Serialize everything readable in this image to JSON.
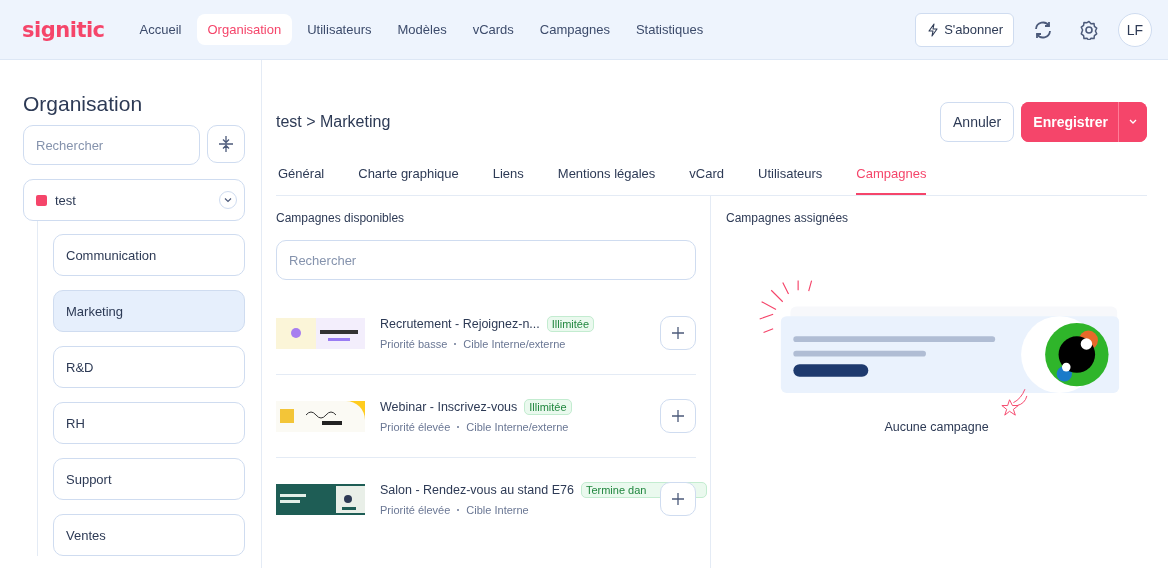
{
  "header": {
    "logo": "signitic",
    "nav": [
      {
        "label": "Accueil",
        "selected": false
      },
      {
        "label": "Organisation",
        "selected": true
      },
      {
        "label": "Utilisateurs",
        "selected": false
      },
      {
        "label": "Modèles",
        "selected": false
      },
      {
        "label": "vCards",
        "selected": false
      },
      {
        "label": "Campagnes",
        "selected": false
      },
      {
        "label": "Statistiques",
        "selected": false
      }
    ],
    "subscribe": "S'abonner",
    "avatar": "LF"
  },
  "sidebar": {
    "title": "Organisation",
    "search": {
      "placeholder": "Rechercher"
    },
    "tree": {
      "label": "test",
      "color": "#f5456a",
      "expanded": true,
      "children": [
        {
          "label": "Communication",
          "selected": false
        },
        {
          "label": "Marketing",
          "selected": true
        },
        {
          "label": "R&D",
          "selected": false
        },
        {
          "label": "RH",
          "selected": false
        },
        {
          "label": "Support",
          "selected": false
        },
        {
          "label": "Ventes",
          "selected": false
        }
      ]
    }
  },
  "main": {
    "breadcrumb": "test > Marketing",
    "cancel": "Annuler",
    "save": "Enregistrer",
    "tabs": [
      {
        "label": "Général",
        "selected": false
      },
      {
        "label": "Charte graphique",
        "selected": false
      },
      {
        "label": "Liens",
        "selected": false
      },
      {
        "label": "Mentions légales",
        "selected": false
      },
      {
        "label": "vCard",
        "selected": false
      },
      {
        "label": "Utilisateurs",
        "selected": false
      },
      {
        "label": "Campagnes",
        "selected": true
      }
    ],
    "available": {
      "title": "Campagnes disponibles",
      "search": {
        "placeholder": "Rechercher"
      },
      "campaigns": [
        {
          "name": "Recrutement - Rejoignez-n...",
          "badge": "Illimitée",
          "priority": "Priorité basse",
          "target": "Cible Interne/externe",
          "kind": "picture"
        },
        {
          "name": "Webinar - Inscrivez-vous",
          "badge": "Illimitée",
          "priority": "Priorité élevée",
          "target": "Cible Interne/externe",
          "kind": "picture"
        },
        {
          "name": "Salon - Rendez-vous au stand E76",
          "badge": "Termine dan",
          "priority": "Priorité élevée",
          "target": "Cible Interne",
          "kind": "picture"
        }
      ]
    },
    "assigned": {
      "title": "Campagnes assignées",
      "empty": "Aucune campagne"
    }
  }
}
